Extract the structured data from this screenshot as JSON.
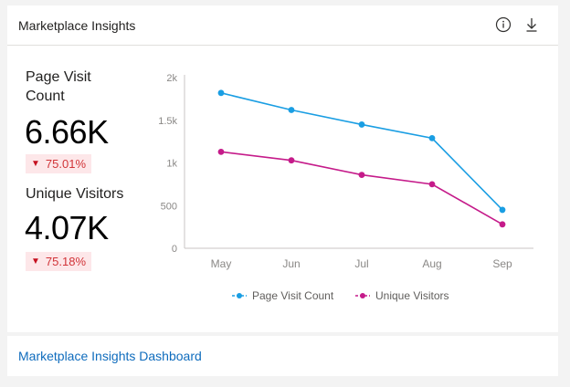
{
  "card": {
    "title": "Marketplace Insights",
    "info_icon": "info-icon",
    "download_icon": "download-icon"
  },
  "metrics": {
    "page_visit": {
      "label": "Page Visit Count",
      "value": "6.66K",
      "change": "75.01%",
      "direction": "down"
    },
    "unique_visitors": {
      "label": "Unique Visitors",
      "value": "4.07K",
      "change": "75.18%",
      "direction": "down"
    }
  },
  "footer": {
    "link_label": "Marketplace Insights Dashboard"
  },
  "colors": {
    "page_visit_series": "#1a9ee3",
    "unique_visitors_series": "#c51b8a",
    "decline_text": "#d13438",
    "decline_bg": "#fde7e9",
    "link": "#0f6cbd"
  },
  "chart_data": {
    "type": "line",
    "x": [
      "May",
      "Jun",
      "Jul",
      "Aug",
      "Sep"
    ],
    "y_ticks": [
      "0",
      "500",
      "1k",
      "1.5k",
      "2k"
    ],
    "ylim": [
      0,
      2000
    ],
    "grid": false,
    "legend_position": "bottom",
    "series": [
      {
        "name": "Page Visit Count",
        "values": [
          1820,
          1620,
          1450,
          1290,
          450
        ]
      },
      {
        "name": "Unique Visitors",
        "values": [
          1130,
          1030,
          860,
          750,
          280
        ]
      }
    ]
  }
}
